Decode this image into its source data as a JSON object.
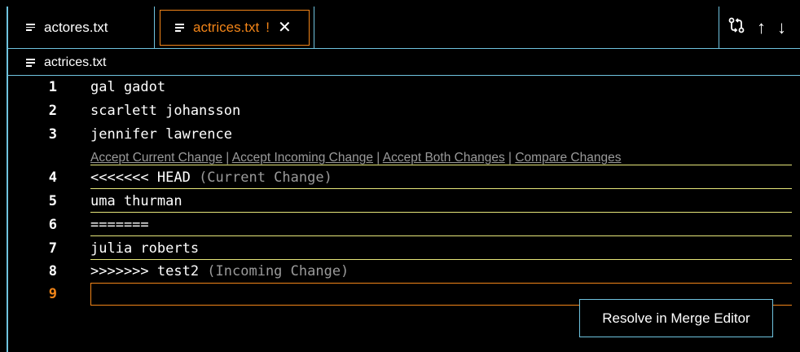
{
  "tabs": [
    {
      "label": "actores.txt",
      "active": false,
      "icon": "file-lines-icon"
    },
    {
      "label": "actrices.txt",
      "active": true,
      "modified": "!",
      "close": "✕",
      "icon": "file-lines-icon"
    }
  ],
  "toolbar": {
    "compare_icon": "⇅",
    "up_icon": "↑",
    "down_icon": "↓"
  },
  "breadcrumb": {
    "file": "actrices.txt"
  },
  "lines": [
    {
      "n": "1",
      "text": "gal gadot"
    },
    {
      "n": "2",
      "text": "scarlett johansson"
    },
    {
      "n": "3",
      "text": "jennifer lawrence"
    },
    {
      "n": "4",
      "text": "<<<<<<< HEAD",
      "suffix": " (Current Change)"
    },
    {
      "n": "5",
      "text": "uma thurman"
    },
    {
      "n": "6",
      "text": "======="
    },
    {
      "n": "7",
      "text": "julia roberts"
    },
    {
      "n": "8",
      "text": ">>>>>>> test2",
      "suffix": " (Incoming Change)"
    },
    {
      "n": "9",
      "text": ""
    }
  ],
  "codelens": {
    "accept_current": "Accept Current Change",
    "accept_incoming": "Accept Incoming Change",
    "accept_both": "Accept Both Changes",
    "compare": "Compare Changes",
    "sep": " | "
  },
  "merge_button": "Resolve in Merge Editor",
  "colors": {
    "accent_orange": "#f38518",
    "border_blue": "#6fc3df",
    "conflict_rule": "#e6e67a"
  }
}
